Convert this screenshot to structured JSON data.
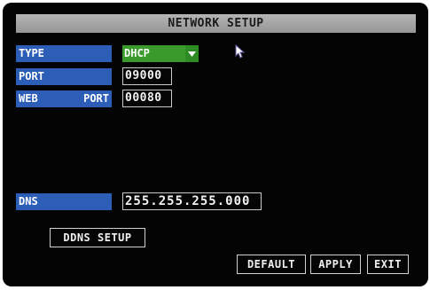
{
  "title": "NETWORK SETUP",
  "labels": {
    "type": "TYPE",
    "port": "PORT",
    "web_port_left": "WEB",
    "web_port_right": "PORT",
    "dns": "DNS"
  },
  "fields": {
    "type_value": "DHCP",
    "port_value": "09000",
    "web_port_value": "00080",
    "dns_value": "255.255.255.000"
  },
  "buttons": {
    "ddns_setup": "DDNS SETUP",
    "default": "DEFAULT",
    "apply": "APPLY",
    "exit": "EXIT"
  },
  "icons": {
    "dropdown": "chevron-down-icon",
    "cursor": "mouse-pointer-icon"
  },
  "colors": {
    "title_bar": "#a6a6a6",
    "label_bg": "#2c5eb8",
    "selected_field": "#3a9a2c",
    "background": "#040404"
  }
}
